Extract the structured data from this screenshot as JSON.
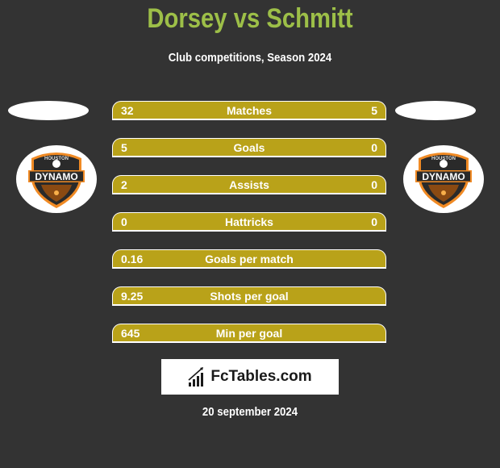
{
  "header": {
    "title": "Dorsey vs Schmitt",
    "subtitle": "Club competitions, Season 2024"
  },
  "players": {
    "left": {
      "name": "Dorsey",
      "club_logo": "houston-dynamo-logo"
    },
    "right": {
      "name": "Schmitt",
      "club_logo": "houston-dynamo-logo"
    }
  },
  "logo_text": {
    "top": "HOUSTON",
    "main": "DYNAMO"
  },
  "colors": {
    "background": "#333333",
    "title": "#9dbf48",
    "bar": "#b9a219",
    "logo_orange": "#f08a24",
    "logo_dark": "#2a2a2a"
  },
  "stats": [
    {
      "label": "Matches",
      "left": "32",
      "right": "5"
    },
    {
      "label": "Goals",
      "left": "5",
      "right": "0"
    },
    {
      "label": "Assists",
      "left": "2",
      "right": "0"
    },
    {
      "label": "Hattricks",
      "left": "0",
      "right": "0"
    },
    {
      "label": "Goals per match",
      "left": "0.16",
      "right": ""
    },
    {
      "label": "Shots per goal",
      "left": "9.25",
      "right": ""
    },
    {
      "label": "Min per goal",
      "left": "645",
      "right": ""
    }
  ],
  "brand": {
    "name": "FcTables.com",
    "icon": "bar-chart-icon"
  },
  "footer": {
    "date": "20 september 2024"
  }
}
